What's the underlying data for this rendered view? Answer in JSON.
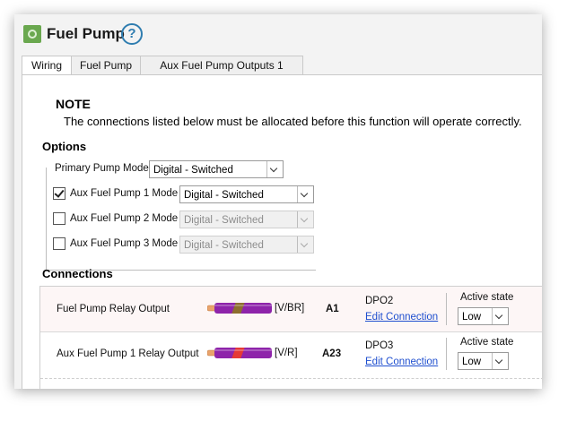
{
  "window": {
    "title": "Fuel Pump",
    "help_symbol": "?"
  },
  "tabs": [
    {
      "label": "Wiring",
      "active": true
    },
    {
      "label": "Fuel Pump",
      "active": false
    },
    {
      "label": "Aux Fuel Pump Outputs 1",
      "active": false
    }
  ],
  "note": {
    "title": "NOTE",
    "text": "The connections listed below must be allocated before this function will operate correctly."
  },
  "options": {
    "heading": "Options",
    "primary": {
      "label": "Primary Pump Mode",
      "value": "Digital - Switched"
    },
    "aux": [
      {
        "label": "Aux Fuel Pump 1 Mode",
        "checked": true,
        "value": "Digital - Switched",
        "enabled": true
      },
      {
        "label": "Aux Fuel Pump 2 Mode",
        "checked": false,
        "value": "Digital - Switched",
        "enabled": false
      },
      {
        "label": "Aux Fuel Pump 3 Mode",
        "checked": false,
        "value": "Digital - Switched",
        "enabled": false
      }
    ]
  },
  "connections": {
    "heading": "Connections",
    "rows": [
      {
        "name": "Fuel Pump Relay Output",
        "wire_code": "[V/BR]",
        "pin": "A1",
        "output": "DPO2",
        "edit_label": "Edit Connection",
        "active_state_label": "Active state",
        "active_state": "Low",
        "wire_colors": {
          "base": "#8e24aa",
          "stripe": "#8d6e2f"
        }
      },
      {
        "name": "Aux Fuel Pump 1 Relay Output",
        "wire_code": "[V/R]",
        "pin": "A23",
        "output": "DPO3",
        "edit_label": "Edit Connection",
        "active_state_label": "Active state",
        "active_state": "Low",
        "wire_colors": {
          "base": "#8e24aa",
          "stripe": "#e53935"
        }
      }
    ]
  },
  "colors": {
    "accent": "#2f7db0",
    "link": "#1f4fcf",
    "icon_green": "#6aa84f"
  }
}
